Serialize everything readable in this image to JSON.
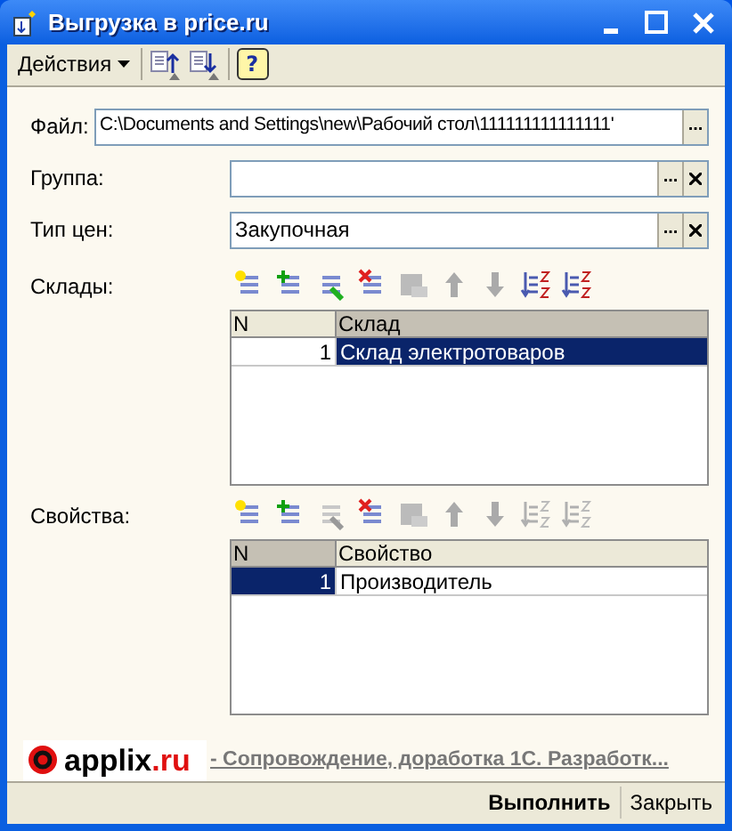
{
  "window": {
    "title": "Выгрузка в price.ru"
  },
  "toolbar": {
    "menu": "Действия",
    "buttons": [
      {
        "kind": "up"
      },
      {
        "kind": "down"
      },
      {
        "kind": "help"
      }
    ]
  },
  "help_label": "?",
  "fields": [
    {
      "label": "Файл:",
      "value": "C:\\Documents and Settings\\new\\Рабочий стол\\111111111111111'",
      "browse": "...",
      "clear": false
    },
    {
      "label": "Группа:",
      "browse": "...",
      "clear": true
    },
    {
      "label": "Тип цен:",
      "value": "Закупочная",
      "browse": "...",
      "clear": true
    }
  ],
  "tables": [
    {
      "label": "Склады:",
      "tools": [
        {
          "kind": "add",
          "disabled": false
        },
        {
          "kind": "copy",
          "disabled": false
        },
        {
          "kind": "edit",
          "disabled": false
        },
        {
          "kind": "delete",
          "disabled": false
        },
        {
          "kind": "save",
          "disabled": true
        },
        {
          "kind": "up",
          "disabled": true
        },
        {
          "kind": "down",
          "disabled": true
        },
        {
          "kind": "sortaz",
          "disabled": false
        },
        {
          "kind": "sortza",
          "disabled": false
        }
      ],
      "columns": [
        {
          "label": "N",
          "selected": false
        },
        {
          "label": "Склад",
          "selected": true
        }
      ],
      "rows": [
        {
          "cells": [
            "1",
            "Склад электротоваров"
          ]
        }
      ]
    },
    {
      "label": "Свойства:",
      "tools": [
        {
          "kind": "add",
          "disabled": false
        },
        {
          "kind": "copy",
          "disabled": false
        },
        {
          "kind": "edit",
          "disabled": true
        },
        {
          "kind": "delete",
          "disabled": false
        },
        {
          "kind": "save",
          "disabled": true
        },
        {
          "kind": "up",
          "disabled": true
        },
        {
          "kind": "down",
          "disabled": true
        },
        {
          "kind": "sortaz",
          "disabled": true
        },
        {
          "kind": "sortza",
          "disabled": true
        }
      ],
      "columns": [
        {
          "label": "N",
          "selected": true
        },
        {
          "label": "Свойство",
          "selected": false
        }
      ],
      "rows": [
        {
          "cells": [
            "1",
            "Производитель"
          ]
        }
      ]
    }
  ],
  "footer": {
    "logo_text": "applix",
    "logo_domain": ".ru",
    "link": "- Сопровождение, доработка 1С. Разработк..."
  },
  "buttons": [
    {
      "label": "Выполнить",
      "default": true
    },
    {
      "label": "Закрыть",
      "default": false
    }
  ]
}
